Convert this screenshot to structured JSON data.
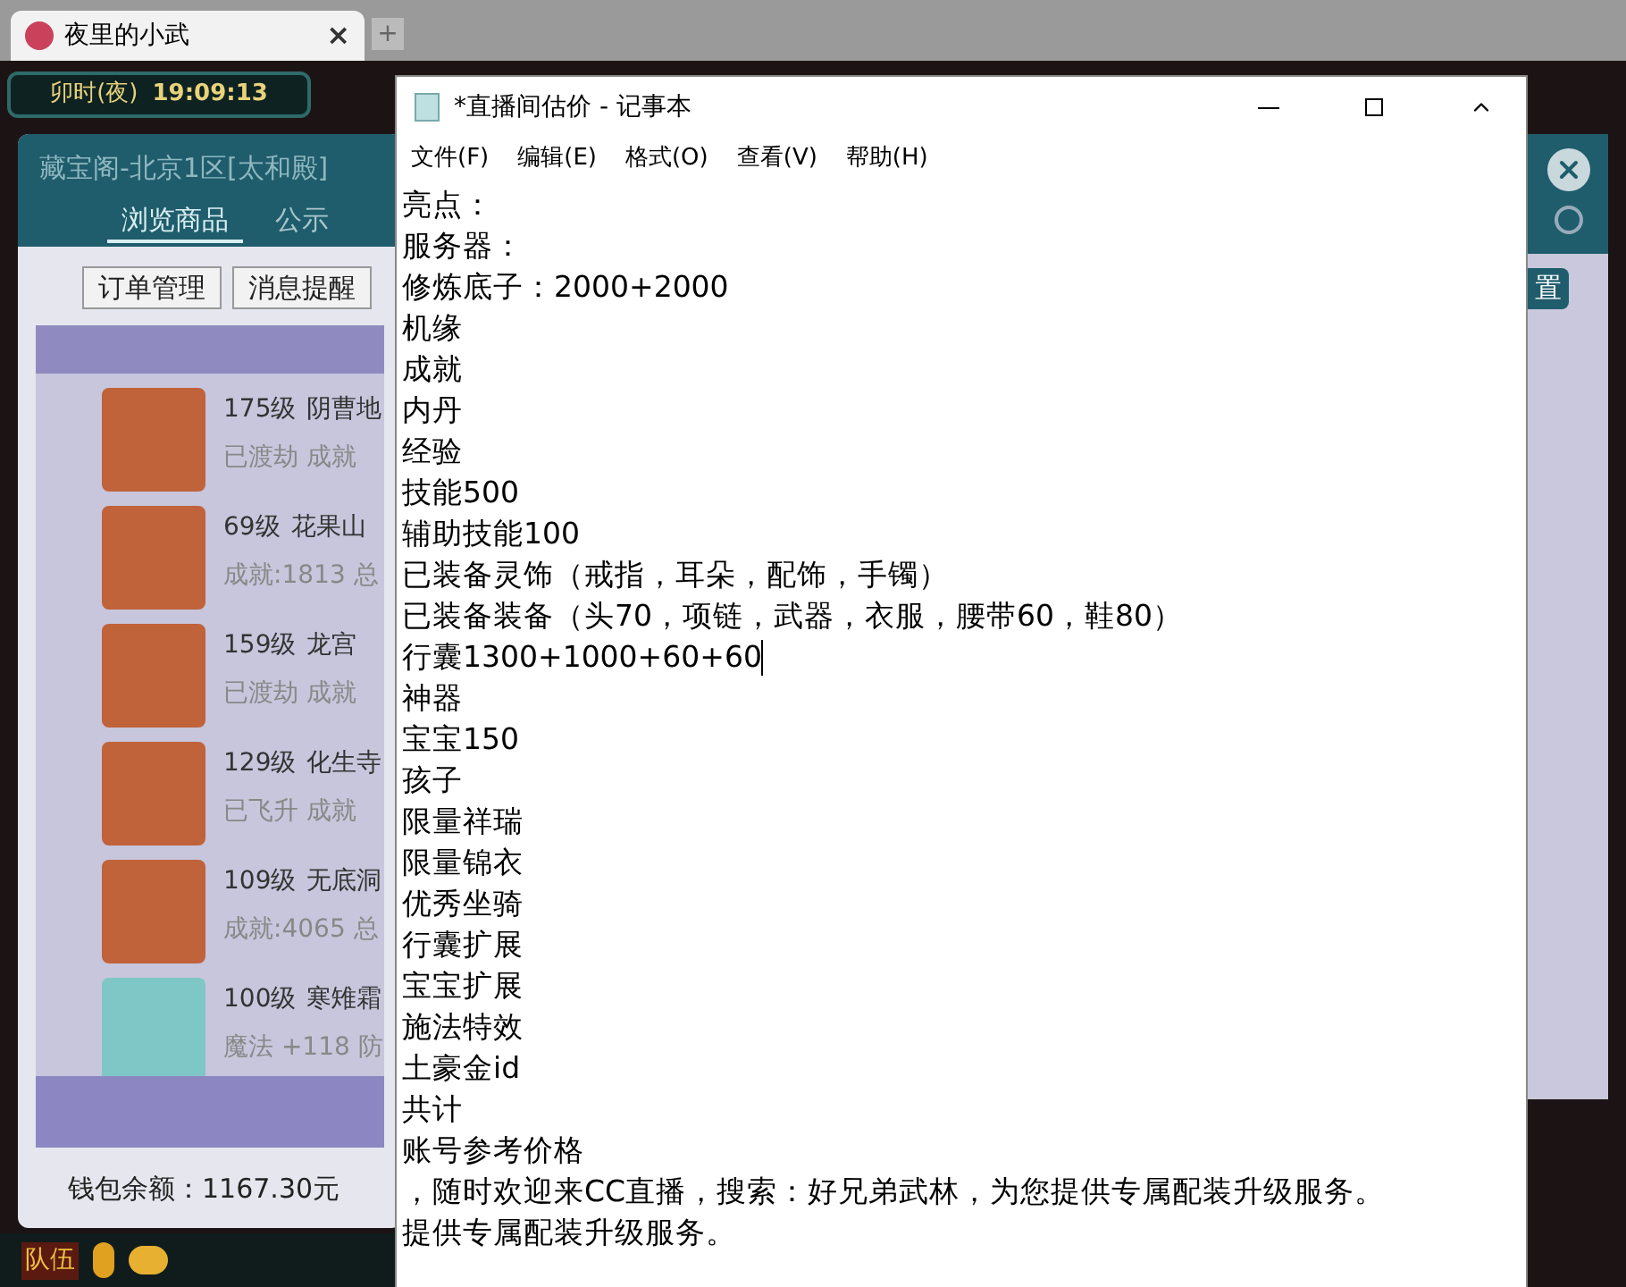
{
  "browser_tab": {
    "title": "夜里的小武",
    "close": "×",
    "new_tab": "+"
  },
  "game": {
    "time_period": "卯时(夜)",
    "clock": "19:09:13",
    "team_button": "队伍"
  },
  "shop_panel": {
    "title": "藏宝阁-北京1区[太和殿]",
    "tabs": [
      {
        "label": "浏览商品",
        "selected": true
      },
      {
        "label": "公示",
        "selected": false
      }
    ],
    "buttons": [
      "订单管理",
      "消息提醒"
    ],
    "right_button": "置",
    "items": [
      {
        "kind": "character",
        "level": "175级",
        "school": "阴曹地",
        "detail": "已渡劫 成就"
      },
      {
        "kind": "character",
        "level": "69级",
        "school": "花果山",
        "detail": "成就:1813 总"
      },
      {
        "kind": "character",
        "level": "159级",
        "school": "龙宫",
        "detail": "已渡劫 成就"
      },
      {
        "kind": "character",
        "level": "129级",
        "school": "化生寺",
        "detail": "已飞升 成就"
      },
      {
        "kind": "character",
        "level": "109级",
        "school": "无底洞",
        "detail": "成就:4065 总"
      },
      {
        "kind": "item",
        "level": "100级",
        "school": "寒雉霜",
        "detail": "魔法 +118 防"
      }
    ],
    "wallet": "钱包余额：1167.30元"
  },
  "notepad": {
    "title": "*直播间估价 - 记事本",
    "menu": [
      "文件(F)",
      "编辑(E)",
      "格式(O)",
      "查看(V)",
      "帮助(H)"
    ],
    "lines": [
      {
        "text": "亮点：",
        "cursor": false
      },
      {
        "text": "服务器：",
        "cursor": false
      },
      {
        "text": "修炼底子：2000+2000",
        "cursor": false
      },
      {
        "text": "机缘",
        "cursor": false
      },
      {
        "text": "成就",
        "cursor": false
      },
      {
        "text": "内丹",
        "cursor": false
      },
      {
        "text": "经验",
        "cursor": false
      },
      {
        "text": "技能500",
        "cursor": false
      },
      {
        "text": "辅助技能100",
        "cursor": false
      },
      {
        "text": "已装备灵饰（戒指，耳朵，配饰，手镯）",
        "cursor": false
      },
      {
        "text": "已装备装备（头70，项链，武器，衣服，腰带60，鞋80）",
        "cursor": false
      },
      {
        "text": "行囊1300+1000+60+60",
        "cursor": true
      },
      {
        "text": "神器",
        "cursor": false
      },
      {
        "text": "宝宝150",
        "cursor": false
      },
      {
        "text": "孩子",
        "cursor": false
      },
      {
        "text": "限量祥瑞",
        "cursor": false
      },
      {
        "text": "限量锦衣",
        "cursor": false
      },
      {
        "text": "优秀坐骑",
        "cursor": false
      },
      {
        "text": "行囊扩展",
        "cursor": false
      },
      {
        "text": "宝宝扩展",
        "cursor": false
      },
      {
        "text": "施法特效",
        "cursor": false
      },
      {
        "text": "土豪金id",
        "cursor": false
      },
      {
        "text": "共计",
        "cursor": false
      },
      {
        "text": "账号参考价格",
        "cursor": false
      },
      {
        "text": "，随时欢迎来CC直播，搜索：好兄弟武林，为您提供专属配装升级服务。",
        "cursor": false
      },
      {
        "text": "提供专属配装升级服务。",
        "cursor": false
      }
    ]
  }
}
